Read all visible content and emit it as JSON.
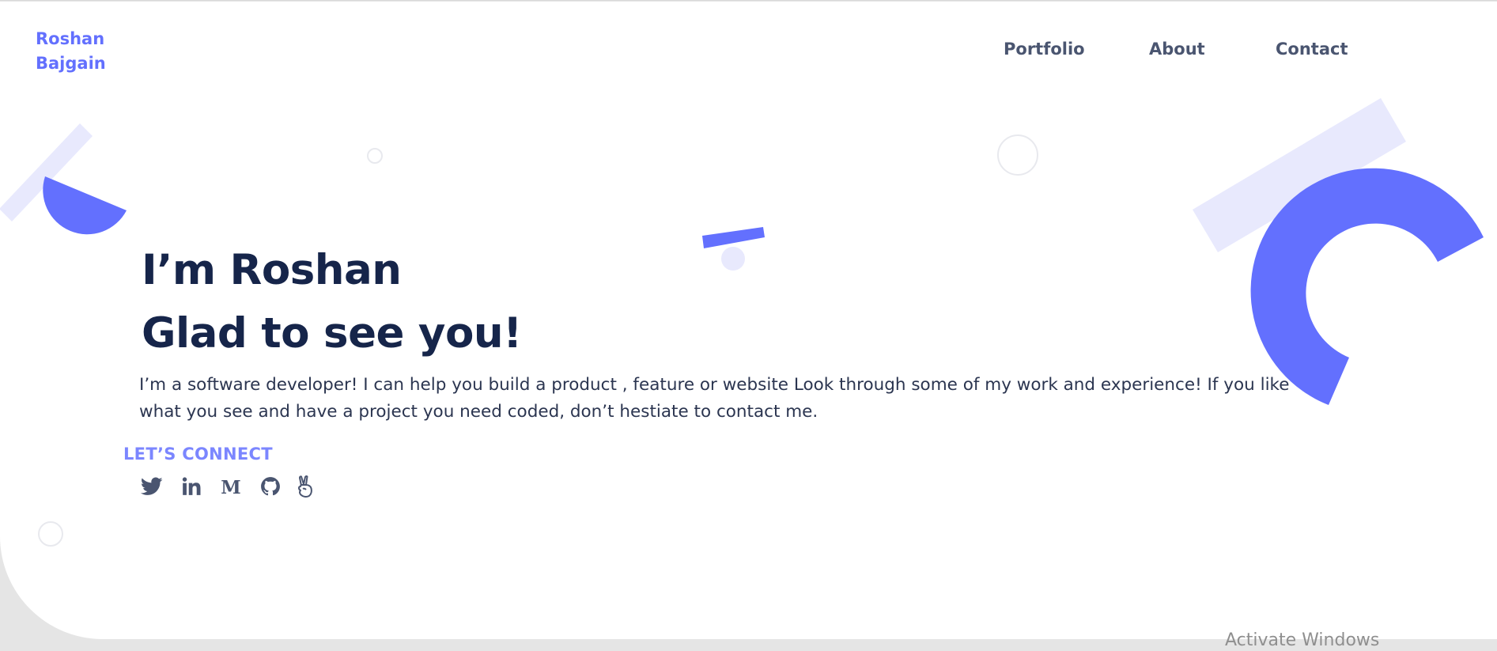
{
  "header": {
    "brand_line1": "Roshan",
    "brand_line2": "Bajgain",
    "nav": [
      "Portfolio",
      "About",
      "Contact"
    ]
  },
  "hero": {
    "greeting": "I’m Roshan",
    "tagline": "Glad to see you!",
    "intro": "I’m a software developer! I can help you build a product , feature or website Look through some of my work and experience! If you like what you see and have a project you need coded, don’t hestiate to contact me."
  },
  "connect": {
    "title": "LET’S CONNECT",
    "icons": [
      "twitter-icon",
      "linkedin-icon",
      "medium-icon",
      "github-icon",
      "angellist-icon"
    ]
  },
  "system": {
    "watermark": "Activate Windows"
  },
  "colors": {
    "accent": "#6370fe",
    "accent_light": "#e8e9fd",
    "heading": "#16254a",
    "nav": "#4a5570",
    "connect": "#7b86ff"
  }
}
